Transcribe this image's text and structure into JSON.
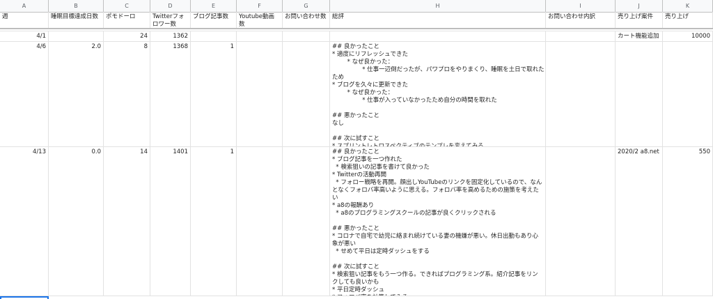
{
  "col_letters": [
    "A",
    "B",
    "C",
    "D",
    "E",
    "F",
    "G",
    "H",
    "I",
    "J",
    "K"
  ],
  "headers": {
    "week": "週",
    "sleep_goal": "睡眠目標達成日数",
    "pomodoro": "ポモドーロ",
    "twitter": "Twitterフォロワー数",
    "blog": "ブログ記事数",
    "youtube": "Youtube動画数",
    "inquiries": "お問い合わせ数",
    "review": "総評",
    "inquiry_detail": "お問い合わせ内訳",
    "sales_case": "売り上げ案件",
    "sales": "売り上げ"
  },
  "rows": [
    {
      "week": "4/1",
      "sleep_goal": "",
      "pomodoro": "24",
      "twitter": "1362",
      "blog": "",
      "youtube": "",
      "inquiries": "",
      "review_lines": [],
      "inquiry_detail": "",
      "sales_case": "カート機能追加",
      "sales": "10000"
    },
    {
      "week": "4/6",
      "sleep_goal": "2.0",
      "pomodoro": "8",
      "twitter": "1368",
      "blog": "1",
      "youtube": "",
      "inquiries": "",
      "review_lines": [
        "## 良かったこと",
        "* 適度にリフレッシュできた",
        "        * なぜ良かった：",
        "                * 仕事一辺倒だったが、パワプロをやりまくり、睡眠を土日で取れた",
        "ため",
        "* ブログを久々に更新できた",
        "        * なぜ良かった：",
        "                * 仕事が入っていなかったため自分の時間を取れた",
        "",
        "## 悪かったこと",
        "なし",
        "",
        "## 次に試すこと",
        "* スプリントレトロスペクティブのテンプレを変えてみる"
      ],
      "inquiry_detail": "",
      "sales_case": "",
      "sales": ""
    },
    {
      "week": "4/13",
      "sleep_goal": "0.0",
      "pomodoro": "14",
      "twitter": "1401",
      "blog": "1",
      "youtube": "",
      "inquiries": "",
      "review_lines": [
        "## 良かったこと",
        "* ブログ記事を一つ作れた",
        "  * 検索狙いの記事を書けて良かった",
        "* Twitterの活動再開",
        "  * フォロー戦略を再開。顔出しYouTubeのリンクを固定化しているので、なん",
        "となくフォロバ率高いように思える。フォロバ率を高めるための施策を考えた",
        "い",
        "* a8の報酬あり",
        "  * a8のプログラミングスクールの記事が良くクリックされる",
        "",
        "## 悪かったこと",
        "* コロナで自宅で幼児に絡まれ続けている妻の機嫌が悪い。休日出勤もあり心",
        "象が悪い",
        "  * せめて平日は定時ダッシュをする",
        "",
        "## 次に試すこと",
        "* 検索狙い記事をもう一つ作る。できればプログラミング系。紹介記事をリン",
        "クしても良いかも",
        "* 平日定時ダッシュ",
        "* フォロバ率を計算してみる"
      ],
      "inquiry_detail": "",
      "sales_case": "2020/2 a8.net",
      "sales": "550"
    }
  ]
}
